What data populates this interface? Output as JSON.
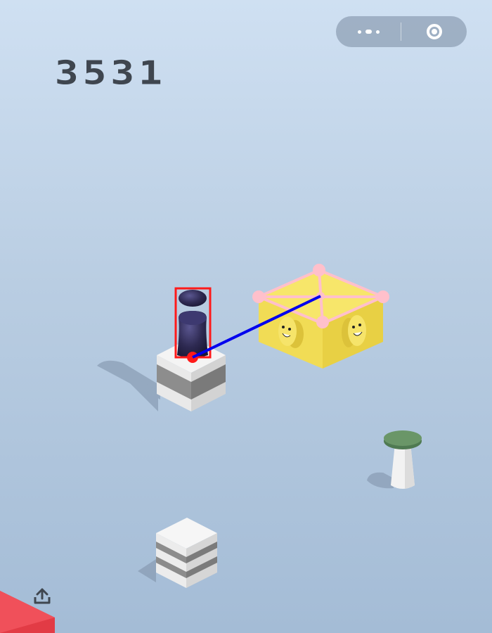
{
  "game": {
    "score": "3531"
  },
  "top_capsule": {
    "menu_icon": "more-dots-icon",
    "close_icon": "target-circle-icon"
  },
  "share": {
    "icon": "share-upload-icon"
  },
  "colors": {
    "background_top": "#cfe0f2",
    "background_bottom": "#a4bcd6",
    "score_text": "#3f464f",
    "yellow_box": "#f5df5c",
    "player": "#2e2a52",
    "detection_box": "#ff1a1a",
    "jump_line": "#0000ee",
    "target_marker": "#ffc0cb",
    "corner_block": "#f0404a"
  }
}
